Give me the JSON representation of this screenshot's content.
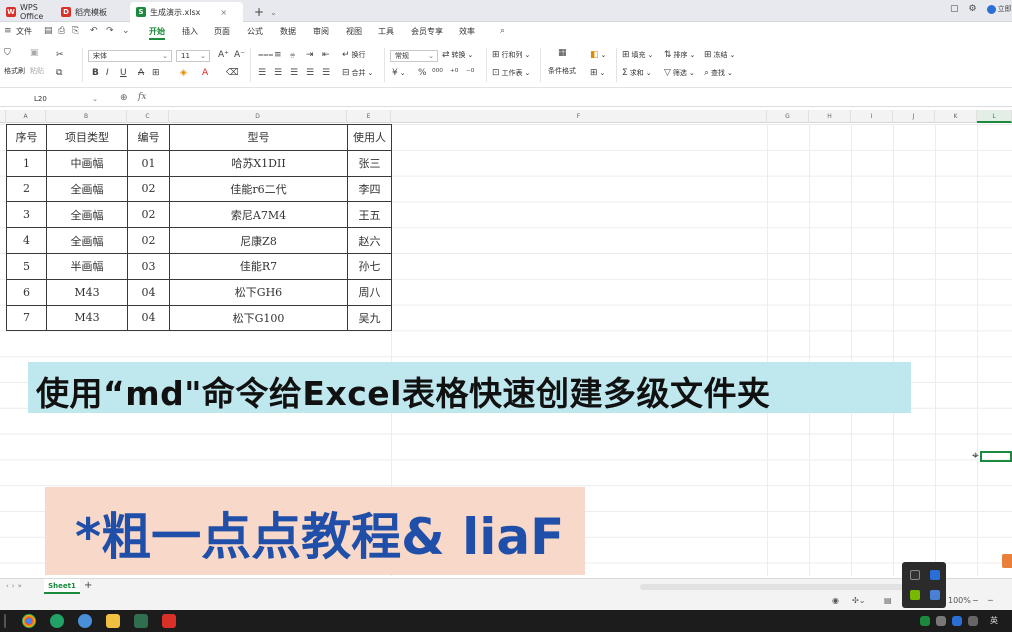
{
  "tabs": [
    {
      "label": "WPS Office",
      "color": "#d9312a"
    },
    {
      "label": "稻壳模板",
      "color": "#d9312a"
    },
    {
      "label": "生成演示.xlsx",
      "color": "#1b8a3c"
    }
  ],
  "menu": {
    "file": "文件",
    "items": [
      "开始",
      "插入",
      "页面",
      "公式",
      "数据",
      "审阅",
      "视图",
      "工具",
      "会员专享",
      "效率"
    ]
  },
  "toolbar": {
    "format_painter": "格式刷",
    "paste": "粘贴",
    "font_name": "宋体",
    "font_size": "11",
    "wrap": "换行",
    "merge": "合并",
    "number_format": "常规",
    "convert": "转换",
    "row_col": "行和列",
    "worksheet": "工作表",
    "cond_format": "条件格式",
    "fill": "填充",
    "sum": "求和",
    "sort": "排序",
    "filter": "筛选",
    "freeze": "冻结",
    "find": "查找"
  },
  "formula_bar": {
    "name_box": "L20",
    "fx": "fx"
  },
  "columns": [
    "A",
    "B",
    "C",
    "D",
    "E",
    "F",
    "G",
    "H",
    "I",
    "J",
    "K",
    "L"
  ],
  "table": {
    "headers": [
      "序号",
      "项目类型",
      "编号",
      "型号",
      "使用人"
    ],
    "rows": [
      [
        "1",
        "中画幅",
        "01",
        "哈苏X1DII",
        "张三"
      ],
      [
        "2",
        "全画幅",
        "02",
        "佳能r6二代",
        "李四"
      ],
      [
        "3",
        "全画幅",
        "02",
        "索尼A7M4",
        "王五"
      ],
      [
        "4",
        "全画幅",
        "02",
        "尼康Z8",
        "赵六"
      ],
      [
        "5",
        "半画幅",
        "03",
        "佳能R7",
        "孙七"
      ],
      [
        "6",
        "M43",
        "04",
        "松下GH6",
        "周八"
      ],
      [
        "7",
        "M43",
        "04",
        "松下G100",
        "吴九"
      ]
    ]
  },
  "overlay": {
    "title": "使用“md\"命令给Excel表格快速创建多级文件夹",
    "subtitle": "*粗一点点教程& liaF"
  },
  "sheet": {
    "active": "Sheet1"
  },
  "status": {
    "zoom": "100%"
  },
  "tray": {
    "lang": "英",
    "user": "立即"
  }
}
